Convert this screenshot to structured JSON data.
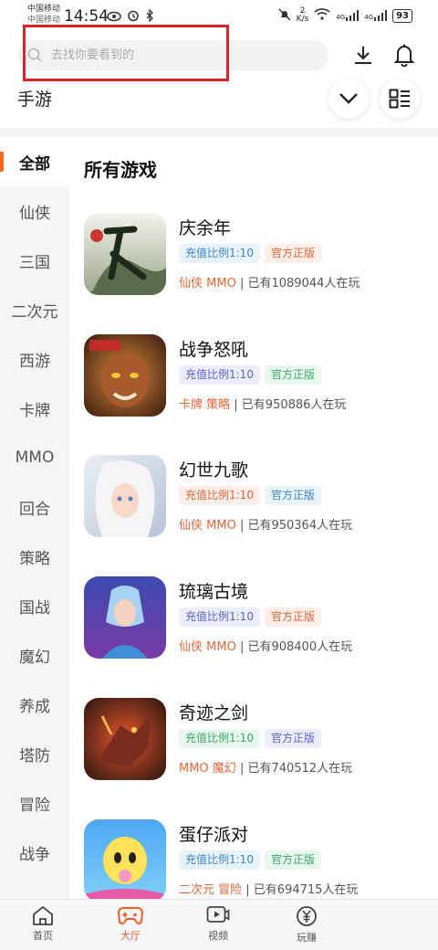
{
  "status_bar": {
    "carrier_1": "中国移动",
    "carrier_2": "中国移动",
    "time": "14:54",
    "net_speed_value": "2",
    "net_speed_unit": "K/s",
    "signal_1": "4G",
    "signal_2": "4G",
    "battery": "93"
  },
  "header": {
    "search_placeholder": "去找你要看到的",
    "page_title": "手游"
  },
  "sidebar": {
    "items": [
      {
        "label": "全部",
        "active": true
      },
      {
        "label": "仙侠"
      },
      {
        "label": "三国"
      },
      {
        "label": "二次元"
      },
      {
        "label": "西游"
      },
      {
        "label": "卡牌"
      },
      {
        "label": "MMO"
      },
      {
        "label": "回合"
      },
      {
        "label": "策略"
      },
      {
        "label": "国战"
      },
      {
        "label": "魔幻"
      },
      {
        "label": "养成"
      },
      {
        "label": "塔防"
      },
      {
        "label": "冒险"
      },
      {
        "label": "战争"
      }
    ]
  },
  "list": {
    "title": "所有游戏",
    "games": [
      {
        "name": "庆余年",
        "tag1": "充值比例1:10",
        "tag2": "官方正版",
        "genre": "仙侠  MMO",
        "players": "| 已有1089044人在玩"
      },
      {
        "name": "战争怒吼",
        "tag1": "充值比例1:10",
        "tag2": "官方正版",
        "genre": "卡牌  策略",
        "players": "| 已有950886人在玩"
      },
      {
        "name": "幻世九歌",
        "tag1": "充值比例1:10",
        "tag2": "官方正版",
        "genre": "仙侠  MMO",
        "players": "| 已有950364人在玩"
      },
      {
        "name": "琉璃古境",
        "tag1": "充值比例1:10",
        "tag2": "官方正版",
        "genre": "仙侠  MMO",
        "players": "| 已有908400人在玩"
      },
      {
        "name": "奇迹之剑",
        "tag1": "充值比例1:10",
        "tag2": "官方正版",
        "genre": "MMO  魔幻",
        "players": "| 已有740512人在玩"
      },
      {
        "name": "蛋仔派对",
        "tag1": "充值比例1:10",
        "tag2": "官方正版",
        "genre": "二次元  冒险",
        "players": "| 已有694715人在玩"
      }
    ]
  },
  "bottom_nav": {
    "items": [
      {
        "label": "首页"
      },
      {
        "label": "大厅",
        "active": true
      },
      {
        "label": "视频"
      },
      {
        "label": "玩赚"
      }
    ]
  },
  "colors": {
    "accent": "#f15b2a",
    "highlight_frame": "#d9222a"
  }
}
